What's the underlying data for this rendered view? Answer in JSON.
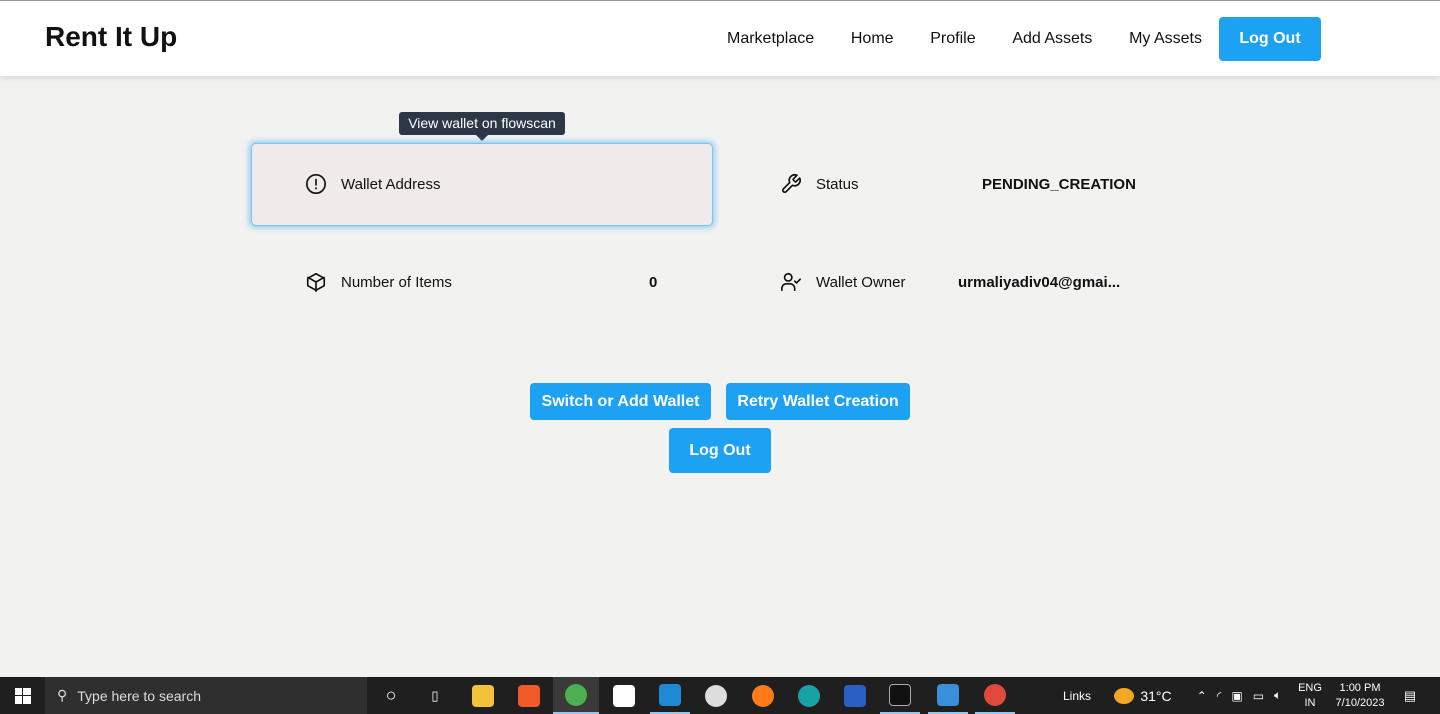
{
  "brand": "Rent It Up",
  "nav": {
    "items": [
      "Marketplace",
      "Home",
      "Profile",
      "Add Assets",
      "My Assets"
    ],
    "logout": "Log Out"
  },
  "tooltip": "View wallet on flowscan",
  "wallet": {
    "address_label": "Wallet Address",
    "status_label": "Status",
    "status_value": "PENDING_CREATION",
    "items_label": "Number of Items",
    "items_value": "0",
    "owner_label": "Wallet Owner",
    "owner_value": "urmaliyadiv04@gmai..."
  },
  "actions": {
    "switch": "Switch or Add Wallet",
    "retry": "Retry Wallet Creation",
    "logout": "Log Out"
  },
  "taskbar": {
    "search_placeholder": "Type here to search",
    "links": "Links",
    "temp": "31°C",
    "lang1": "ENG",
    "lang2": "IN",
    "time": "1:00 PM",
    "date": "7/10/2023"
  },
  "colors": {
    "accent": "#1da1f2"
  }
}
